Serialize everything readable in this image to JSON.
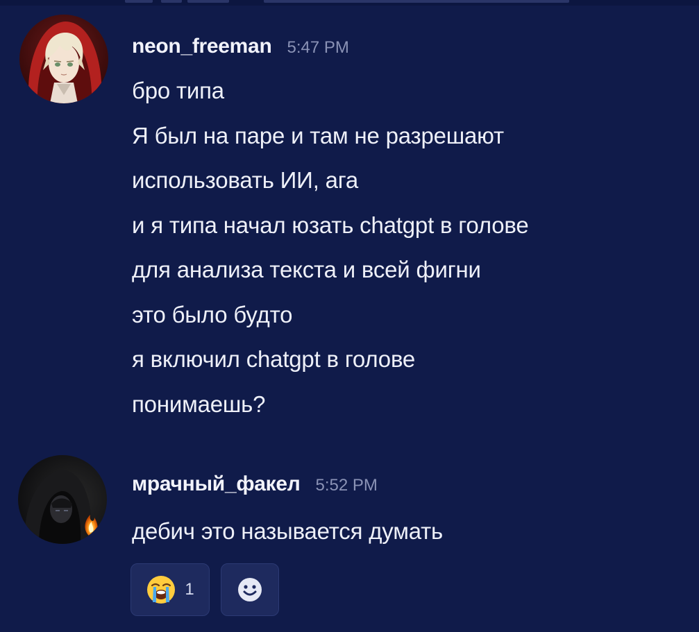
{
  "messages": [
    {
      "username": "neon_freeman",
      "time": "5:47 PM",
      "avatar_icon": "anime-boy-red-hood-avatar",
      "lines": [
        "бро типа",
        "Я был на паре и там не разрешают",
        "использовать ИИ, ага",
        "и я типа начал юзать chatgpt в голове",
        "для анализа текста и всей фигни",
        "это было будто",
        "я включил chatgpt в голове",
        "понимаешь?"
      ]
    },
    {
      "username": "мрачный_факел",
      "time": "5:52 PM",
      "avatar_icon": "dark-hooded-figure-flame-avatar",
      "lines": [
        "дебич это называется думать"
      ]
    }
  ],
  "reactions": [
    {
      "emoji": "😭",
      "icon": "loudly-crying-face-emoji",
      "count": "1"
    },
    {
      "icon": "add-reaction-smiley-icon"
    }
  ],
  "colors": {
    "background": "#101b4a",
    "text": "#eef0f8",
    "timestamp": "#8a92b5",
    "reaction_bg": "#1e2a5e"
  }
}
